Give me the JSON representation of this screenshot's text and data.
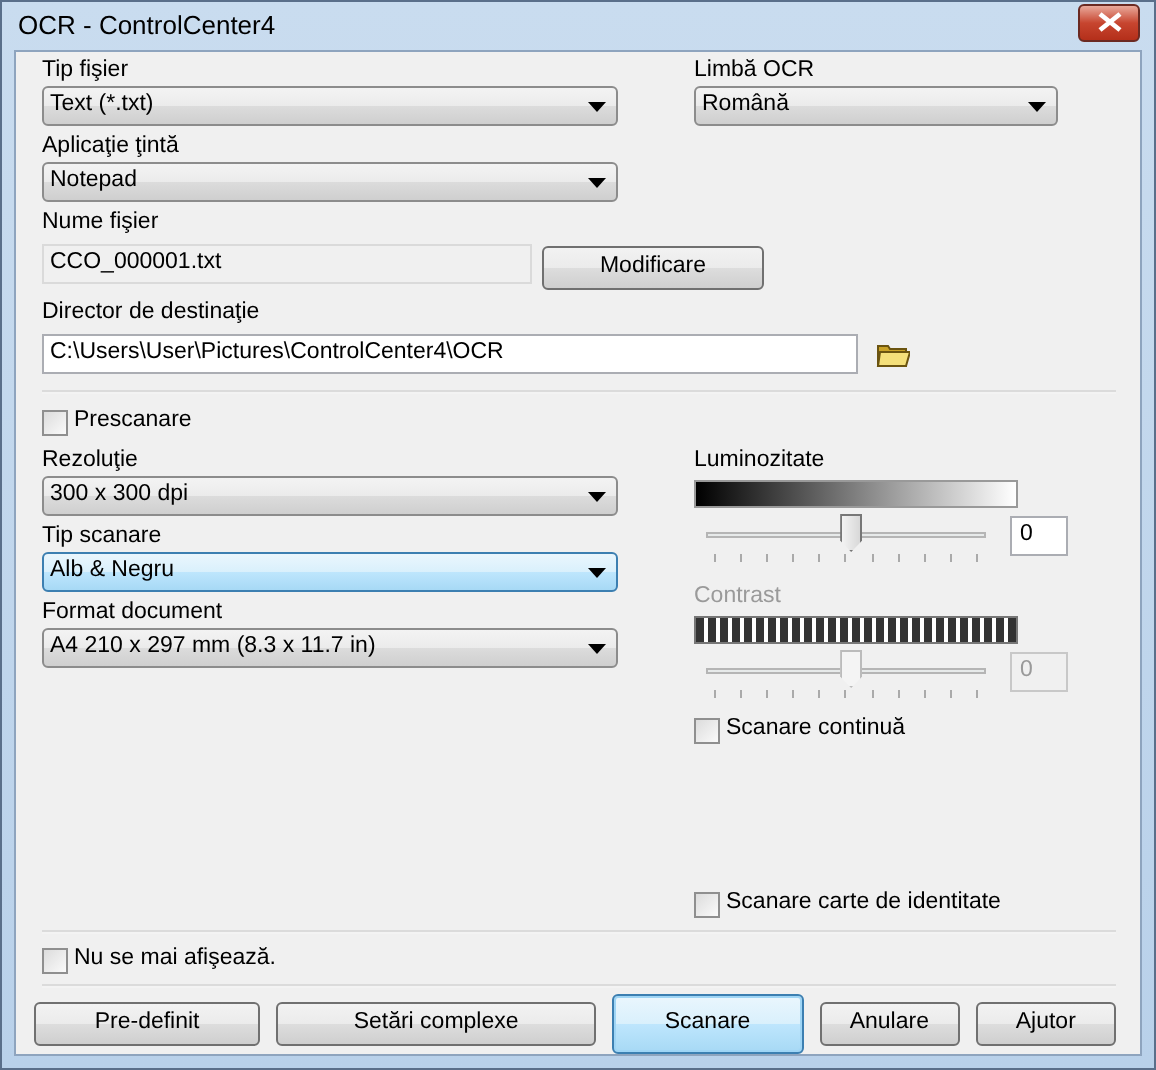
{
  "window": {
    "title": "OCR - ControlCenter4"
  },
  "file_type": {
    "label": "Tip fişier",
    "value": "Text (*.txt)"
  },
  "ocr_language": {
    "label": "Limbă OCR",
    "value": "Română"
  },
  "target_app": {
    "label": "Aplicaţie ţintă",
    "value": "Notepad"
  },
  "file_name": {
    "label": "Nume fişier",
    "value": "CCO_000001.txt",
    "button": "Modificare"
  },
  "destination": {
    "label": "Director de destinaţie",
    "value": "C:\\Users\\User\\Pictures\\ControlCenter4\\OCR"
  },
  "prescan": {
    "label": "Prescanare",
    "checked": false
  },
  "resolution": {
    "label": "Rezoluţie",
    "value": "300 x 300 dpi",
    "focused": false
  },
  "scan_type": {
    "label": "Tip scanare",
    "value": "Alb & Negru",
    "focused": true
  },
  "document_size": {
    "label": "Format document",
    "value": "A4 210 x 297 mm (8.3 x 11.7 in)",
    "focused": false
  },
  "brightness": {
    "label": "Luminozitate",
    "level": 0.52,
    "value": "0",
    "disabled": false
  },
  "contrast": {
    "label": "Contrast",
    "level": 0.52,
    "value": "0",
    "disabled": true
  },
  "continuous_scan": {
    "label": "Scanare continuă",
    "checked": false
  },
  "id_card_scan": {
    "label": "Scanare carte de identitate",
    "checked": false
  },
  "dont_show": {
    "label": "Nu se mai afişează.",
    "checked": false
  },
  "buttons": [
    {
      "label": "Pre-definit",
      "default": false
    },
    {
      "label": "Setări complexe",
      "default": false
    },
    {
      "label": "Scanare",
      "default": true
    },
    {
      "label": "Anulare",
      "default": false
    },
    {
      "label": "Ajutor",
      "default": false
    }
  ]
}
